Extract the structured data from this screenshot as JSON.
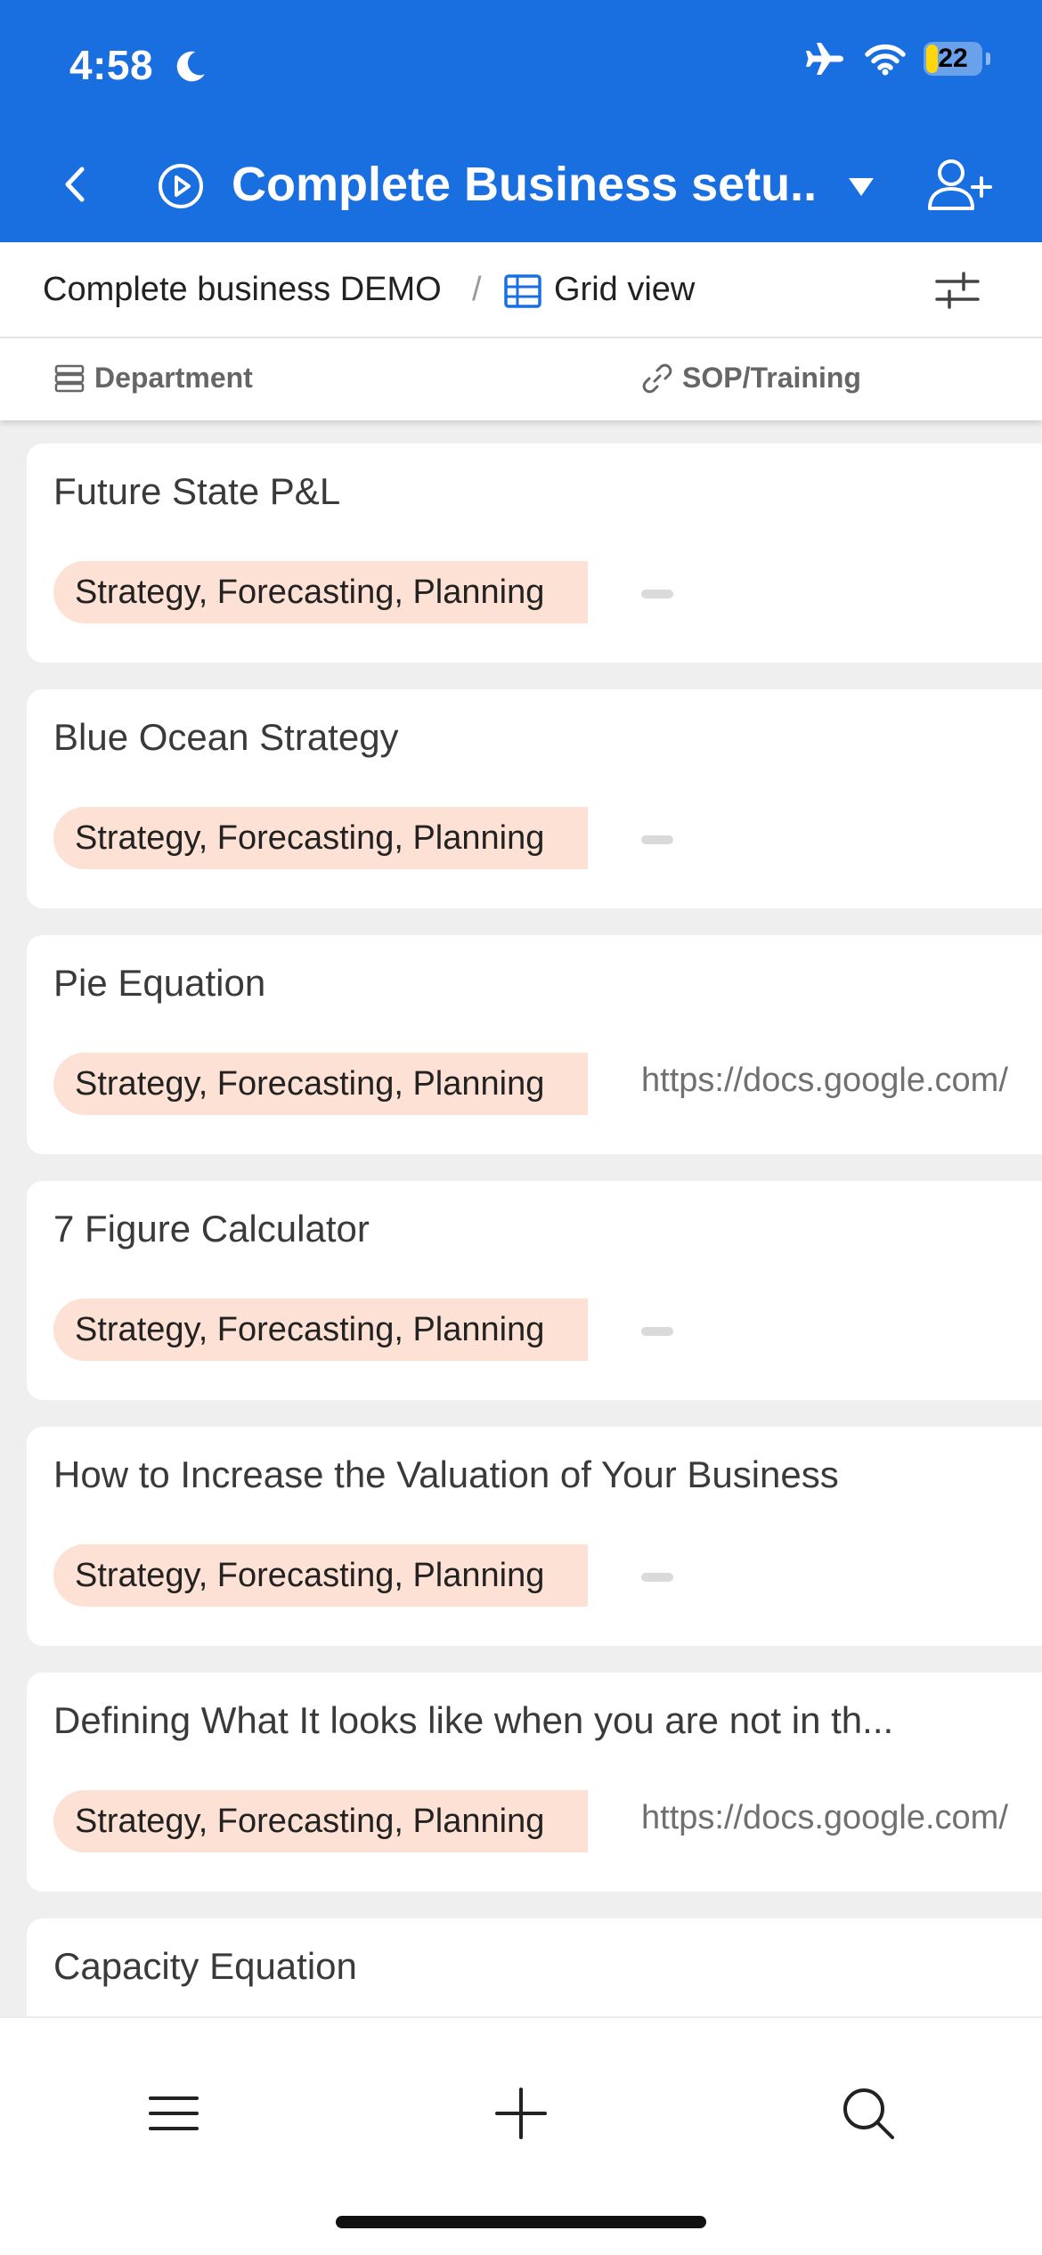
{
  "status_bar": {
    "time": "4:58",
    "battery_level": "22",
    "battery_fraction": 0.22
  },
  "nav": {
    "base_title": "Complete Business setu..."
  },
  "breadcrumb": {
    "base": "Complete business DEMO",
    "separator": "/",
    "view": "Grid view"
  },
  "columns": {
    "department": "Department",
    "sop_training": "SOP/Training"
  },
  "records": [
    {
      "title": "Future State P&L",
      "department": "Strategy, Forecasting, Planning",
      "sop": ""
    },
    {
      "title": "Blue Ocean Strategy",
      "department": "Strategy, Forecasting, Planning",
      "sop": ""
    },
    {
      "title": "Pie Equation",
      "department": "Strategy, Forecasting, Planning",
      "sop": "https://docs.google.com/"
    },
    {
      "title": "7 Figure Calculator",
      "department": "Strategy, Forecasting, Planning",
      "sop": ""
    },
    {
      "title": "How to Increase the Valuation of Your Business",
      "department": "Strategy, Forecasting, Planning",
      "sop": ""
    },
    {
      "title": "Defining What It looks like when you are not in th...",
      "department": "Strategy, Forecasting, Planning",
      "sop": "https://docs.google.com/"
    },
    {
      "title": "Capacity Equation",
      "department": "",
      "sop": ""
    }
  ],
  "colors": {
    "header_bg": "#1a6fe0",
    "tag_bg": "#fde1d4",
    "battery": "#ffd60a"
  },
  "icons": {
    "status": [
      "moon-icon",
      "airplane-icon",
      "wifi-icon",
      "battery-icon"
    ],
    "nav": [
      "back-icon",
      "play-icon",
      "caret-down-icon",
      "add-user-icon"
    ],
    "tabbar": [
      "menu-icon",
      "plus-icon",
      "search-icon"
    ]
  }
}
